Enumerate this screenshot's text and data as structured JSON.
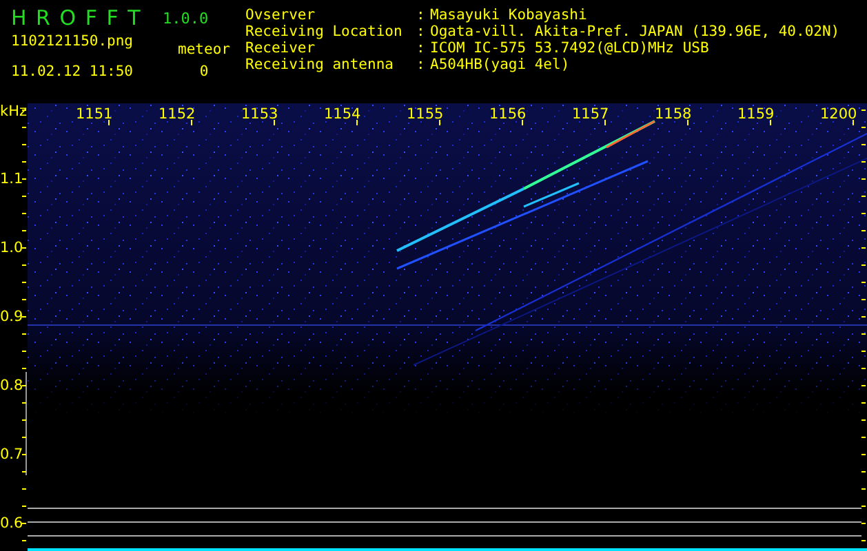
{
  "app": {
    "title": "H R O F F T",
    "version": "1.0.0",
    "filename": "1102121150.png",
    "datetime": "11.02.12 11:50",
    "meteor_label": "meteor",
    "meteor_count": "0"
  },
  "info": [
    {
      "label": "Ovserver",
      "separator": ":",
      "value": "Masayuki Kobayashi"
    },
    {
      "label": "Receiving Location",
      "separator": ":",
      "value": "Ogata-vill. Akita-Pref. JAPAN (139.96E, 40.02N)"
    },
    {
      "label": "Receiver",
      "separator": ":",
      "value": "ICOM IC-575 53.7492(@LCD)MHz USB"
    },
    {
      "label": "Receiving antenna",
      "separator": ":",
      "value": "A504HB(yagi 4el)"
    }
  ],
  "plot": {
    "y_unit": "kHz",
    "time_labels": [
      "1151",
      "1152",
      "1153",
      "1154",
      "1155",
      "1156",
      "1157",
      "1158",
      "1159",
      "1200"
    ],
    "freq_labels": [
      "1.1",
      "1.0",
      "0.9",
      "0.8",
      "0.7",
      "0.6"
    ]
  }
}
